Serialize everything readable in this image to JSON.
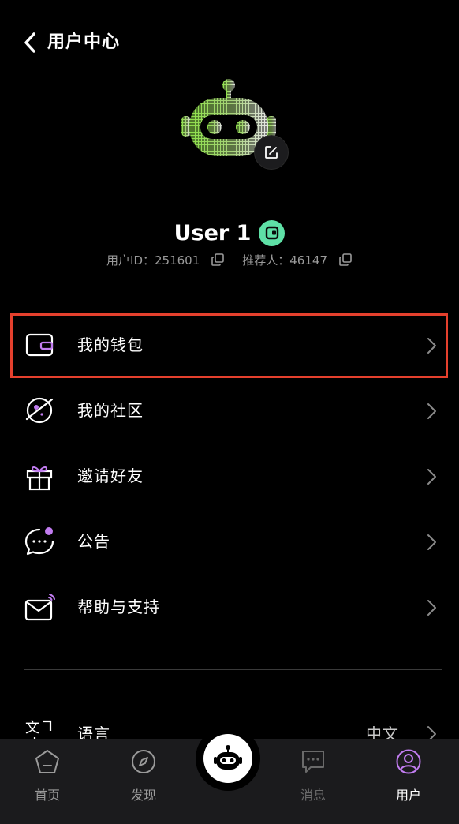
{
  "header": {
    "title": "用户中心"
  },
  "profile": {
    "name": "User 1",
    "user_id_label": "用户ID：251601",
    "referrer_label": "推荐人：46147"
  },
  "menu": {
    "items": [
      {
        "label": "我的钱包",
        "icon": "wallet-icon"
      },
      {
        "label": "我的社区",
        "icon": "planet-icon"
      },
      {
        "label": "邀请好友",
        "icon": "gift-icon"
      },
      {
        "label": "公告",
        "icon": "chat-bubble-icon"
      },
      {
        "label": "帮助与支持",
        "icon": "mail-icon"
      }
    ]
  },
  "language": {
    "label": "语言",
    "value": "中文"
  },
  "tabbar": {
    "tabs": [
      {
        "label": "首页",
        "icon": "home-icon"
      },
      {
        "label": "发现",
        "icon": "compass-icon"
      },
      {
        "label": "消息",
        "icon": "message-icon"
      },
      {
        "label": "用户",
        "icon": "user-icon",
        "active": true
      }
    ]
  },
  "colors": {
    "accent_purple": "#c17cf0",
    "badge_green": "#5ee0a6",
    "highlight_red": "#e5402d",
    "avatar_green": "#8ee04a"
  }
}
